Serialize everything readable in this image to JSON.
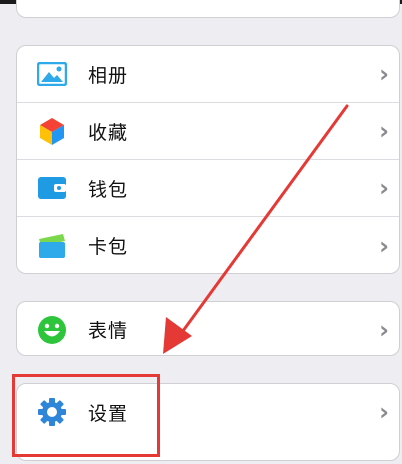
{
  "menu": {
    "items": [
      {
        "label": "相册",
        "icon": "photo-album-icon"
      },
      {
        "label": "收藏",
        "icon": "favorites-cube-icon"
      },
      {
        "label": "钱包",
        "icon": "wallet-icon"
      },
      {
        "label": "卡包",
        "icon": "card-pack-icon"
      }
    ]
  },
  "emoji": {
    "label": "表情",
    "icon": "emoji-smile-icon"
  },
  "settings": {
    "label": "设置",
    "icon": "gear-icon"
  },
  "chevron": "›",
  "colors": {
    "background": "#ededf2",
    "card": "#ffffff",
    "annotation_red": "#e53935",
    "album_blue": "#2ea9ea",
    "wallet_blue": "#1e9be3",
    "emoji_green": "#2ec53c",
    "gear_blue": "#2f86d9"
  }
}
